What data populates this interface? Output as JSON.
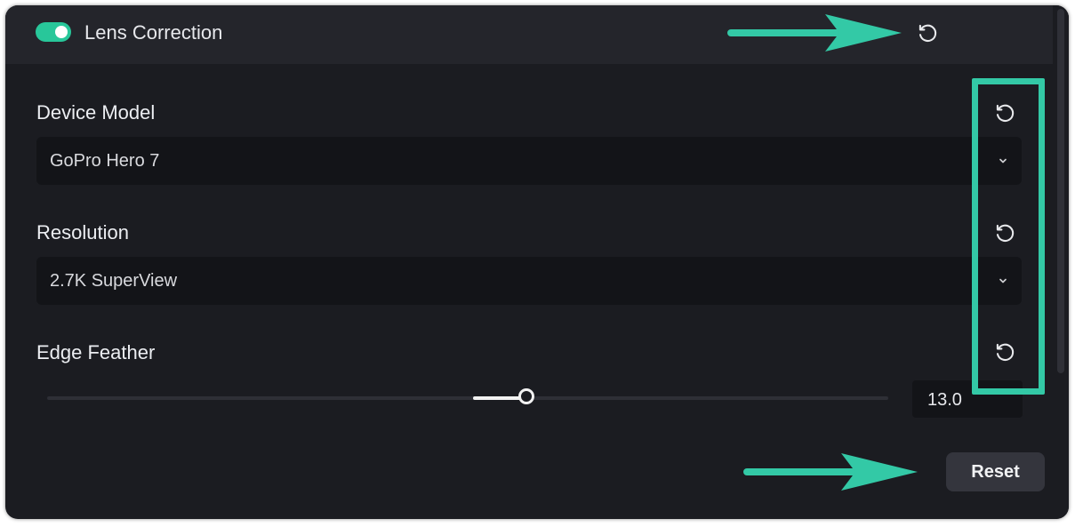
{
  "header": {
    "title": "Lens Correction",
    "toggle_on": true,
    "toggle_color": "#28c79a"
  },
  "fields": {
    "device_model": {
      "label": "Device Model",
      "value": "GoPro Hero 7"
    },
    "resolution": {
      "label": "Resolution",
      "value": "2.7K SuperView"
    },
    "edge_feather": {
      "label": "Edge Feather",
      "value": "13.0",
      "slider_fraction": 0.57
    }
  },
  "footer": {
    "reset_label": "Reset"
  },
  "icons": {
    "reset": "reset-icon",
    "dropdown": "chevron-down-icon"
  },
  "annotations": {
    "color": "#33c9a6"
  }
}
